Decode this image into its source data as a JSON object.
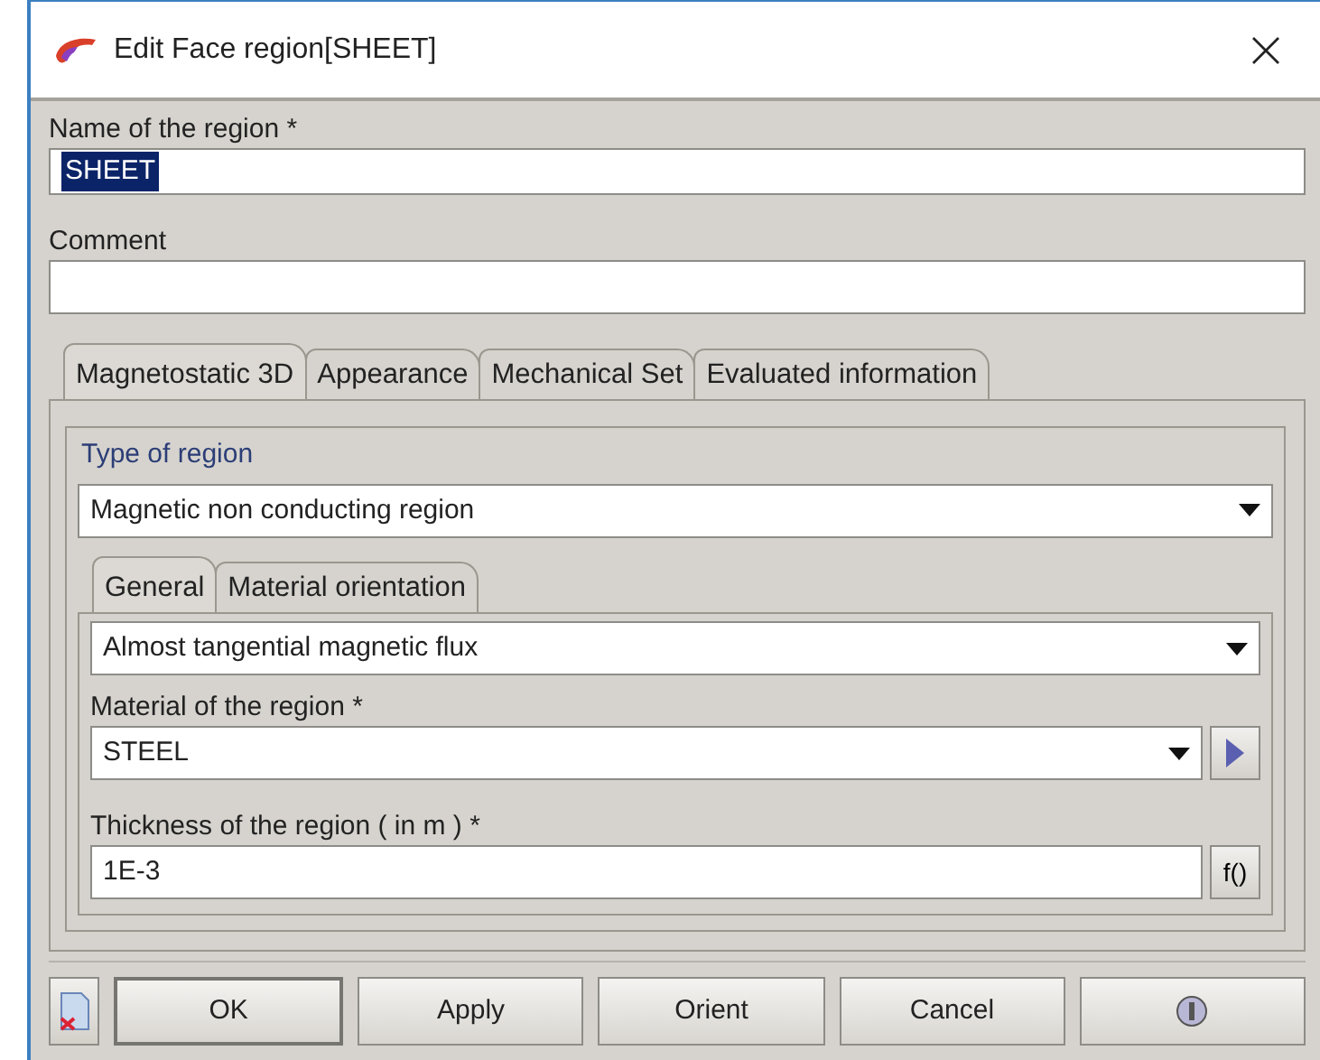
{
  "window": {
    "title": "Edit Face region[SHEET]"
  },
  "name_field": {
    "label": "Name of the region *",
    "value": "SHEET",
    "text_selected": true
  },
  "comment_field": {
    "label": "Comment"
  },
  "tabs": [
    {
      "label": "Magnetostatic 3D",
      "selected": true
    },
    {
      "label": "Appearance",
      "selected": false
    },
    {
      "label": "Mechanical Set",
      "selected": false
    },
    {
      "label": "Evaluated information",
      "selected": false
    }
  ],
  "type_of_region": {
    "legend": "Type of region",
    "value": "Magnetic non conducting region"
  },
  "inner_tabs": [
    {
      "label": "General",
      "selected": true
    },
    {
      "label": "Material orientation",
      "selected": false
    }
  ],
  "flux_select": {
    "value": "Almost tangential magnetic flux"
  },
  "material": {
    "label": "Material of the region *",
    "value": "STEEL"
  },
  "thickness": {
    "label": "Thickness of the region ( in m ) *",
    "value": "1E-3",
    "function_button": "f()"
  },
  "buttons": [
    {
      "label": "OK",
      "kind": "text",
      "default": true
    },
    {
      "label": "Apply",
      "kind": "text",
      "default": false
    },
    {
      "label": "Orient",
      "kind": "text",
      "default": false
    },
    {
      "label": "Cancel",
      "kind": "text",
      "default": false
    },
    {
      "kind": "help",
      "default": false
    }
  ]
}
